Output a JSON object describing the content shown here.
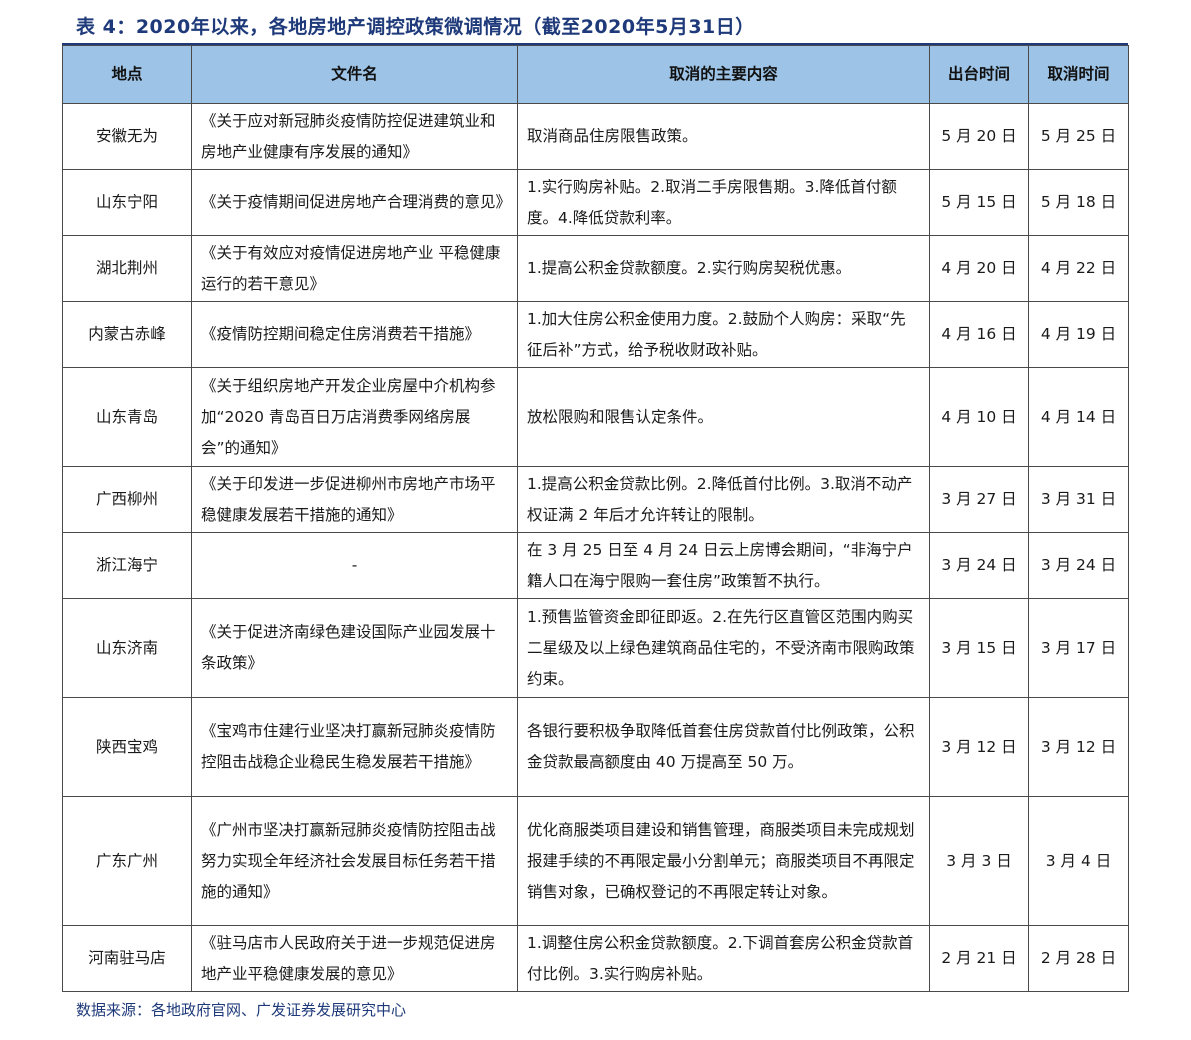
{
  "title": "表 4：2020年以来，各地房地产调控政策微调情况（截至2020年5月31日）",
  "headers": [
    "地点",
    "文件名",
    "取消的主要内容",
    "出台时间",
    "取消时间"
  ],
  "rows": [
    {
      "place": "安徽无为",
      "doc": "《关于应对新冠肺炎疫情防控促进建筑业和房地产业健康有序发展的通知》",
      "content": "取消商品住房限售政策。",
      "issued": "5 月 20 日",
      "cancelled": "5 月 25 日"
    },
    {
      "place": "山东宁阳",
      "doc": "《关于疫情期间促进房地产合理消费的意见》",
      "content": "1.实行购房补贴。2.取消二手房限售期。3.降低首付额度。4.降低贷款利率。",
      "issued": "5 月 15 日",
      "cancelled": "5 月 18 日"
    },
    {
      "place": "湖北荆州",
      "doc": "《关于有效应对疫情促进房地产业 平稳健康运行的若干意见》",
      "content": "1.提高公积金贷款额度。2.实行购房契税优惠。",
      "issued": "4 月 20 日",
      "cancelled": "4 月 22 日"
    },
    {
      "place": "内蒙古赤峰",
      "doc": "《疫情防控期间稳定住房消费若干措施》",
      "content": "1.加大住房公积金使用力度。2.鼓励个人购房：采取“先征后补”方式，给予税收财政补贴。",
      "issued": "4 月 16 日",
      "cancelled": "4 月 19 日"
    },
    {
      "place": "山东青岛",
      "doc": "《关于组织房地产开发企业房屋中介机构参加“2020 青岛百日万店消费季网络房展会”的通知》",
      "content": "放松限购和限售认定条件。",
      "issued": "4 月 10 日",
      "cancelled": "4 月 14 日"
    },
    {
      "place": "广西柳州",
      "doc": "《关于印发进一步促进柳州市房地产市场平稳健康发展若干措施的通知》",
      "content": "1.提高公积金贷款比例。2.降低首付比例。3.取消不动产权证满 2 年后才允许转让的限制。",
      "issued": "3 月 27 日",
      "cancelled": "3 月 31 日"
    },
    {
      "place": "浙江海宁",
      "doc": "-",
      "content": "在 3 月 25 日至 4 月 24 日云上房博会期间，“非海宁户籍人口在海宁限购一套住房”政策暂不执行。",
      "issued": "3 月 24 日",
      "cancelled": "3 月 24 日"
    },
    {
      "place": "山东济南",
      "doc": "《关于促进济南绿色建设国际产业园发展十条政策》",
      "content": "1.预售监管资金即征即返。2.在先行区直管区范围内购买二星级及以上绿色建筑商品住宅的，不受济南市限购政策约束。",
      "issued": "3 月 15 日",
      "cancelled": "3 月 17 日"
    },
    {
      "place": "陕西宝鸡",
      "doc": "《宝鸡市住建行业坚决打赢新冠肺炎疫情防控阻击战稳企业稳民生稳发展若干措施》",
      "content": "各银行要积极争取降低首套住房贷款首付比例政策，公积金贷款最高额度由 40 万提高至 50 万。",
      "issued": "3 月 12 日",
      "cancelled": "3 月 12 日"
    },
    {
      "place": "广东广州",
      "doc": "《广州市坚决打赢新冠肺炎疫情防控阻击战努力实现全年经济社会发展目标任务若干措施的通知》",
      "content": "优化商服类项目建设和销售管理，商服类项目未完成规划报建手续的不再限定最小分割单元；商服类项目不再限定销售对象，已确权登记的不再限定转让对象。",
      "issued": "3 月 3 日",
      "cancelled": "3 月 4 日"
    },
    {
      "place": "河南驻马店",
      "doc": "《驻马店市人民政府关于进一步规范促进房地产业平稳健康发展的意见》",
      "content": "1.调整住房公积金贷款额度。2.下调首套房公积金贷款首付比例。3.实行购房补贴。",
      "issued": "2 月 21 日",
      "cancelled": "2 月 28 日"
    }
  ],
  "source": "数据来源：各地政府官网、广发证券发展研究中心",
  "colors": {
    "header_bg": "#9dc3e6",
    "title": "#1f3a7a",
    "border": "#4a4a4a"
  }
}
